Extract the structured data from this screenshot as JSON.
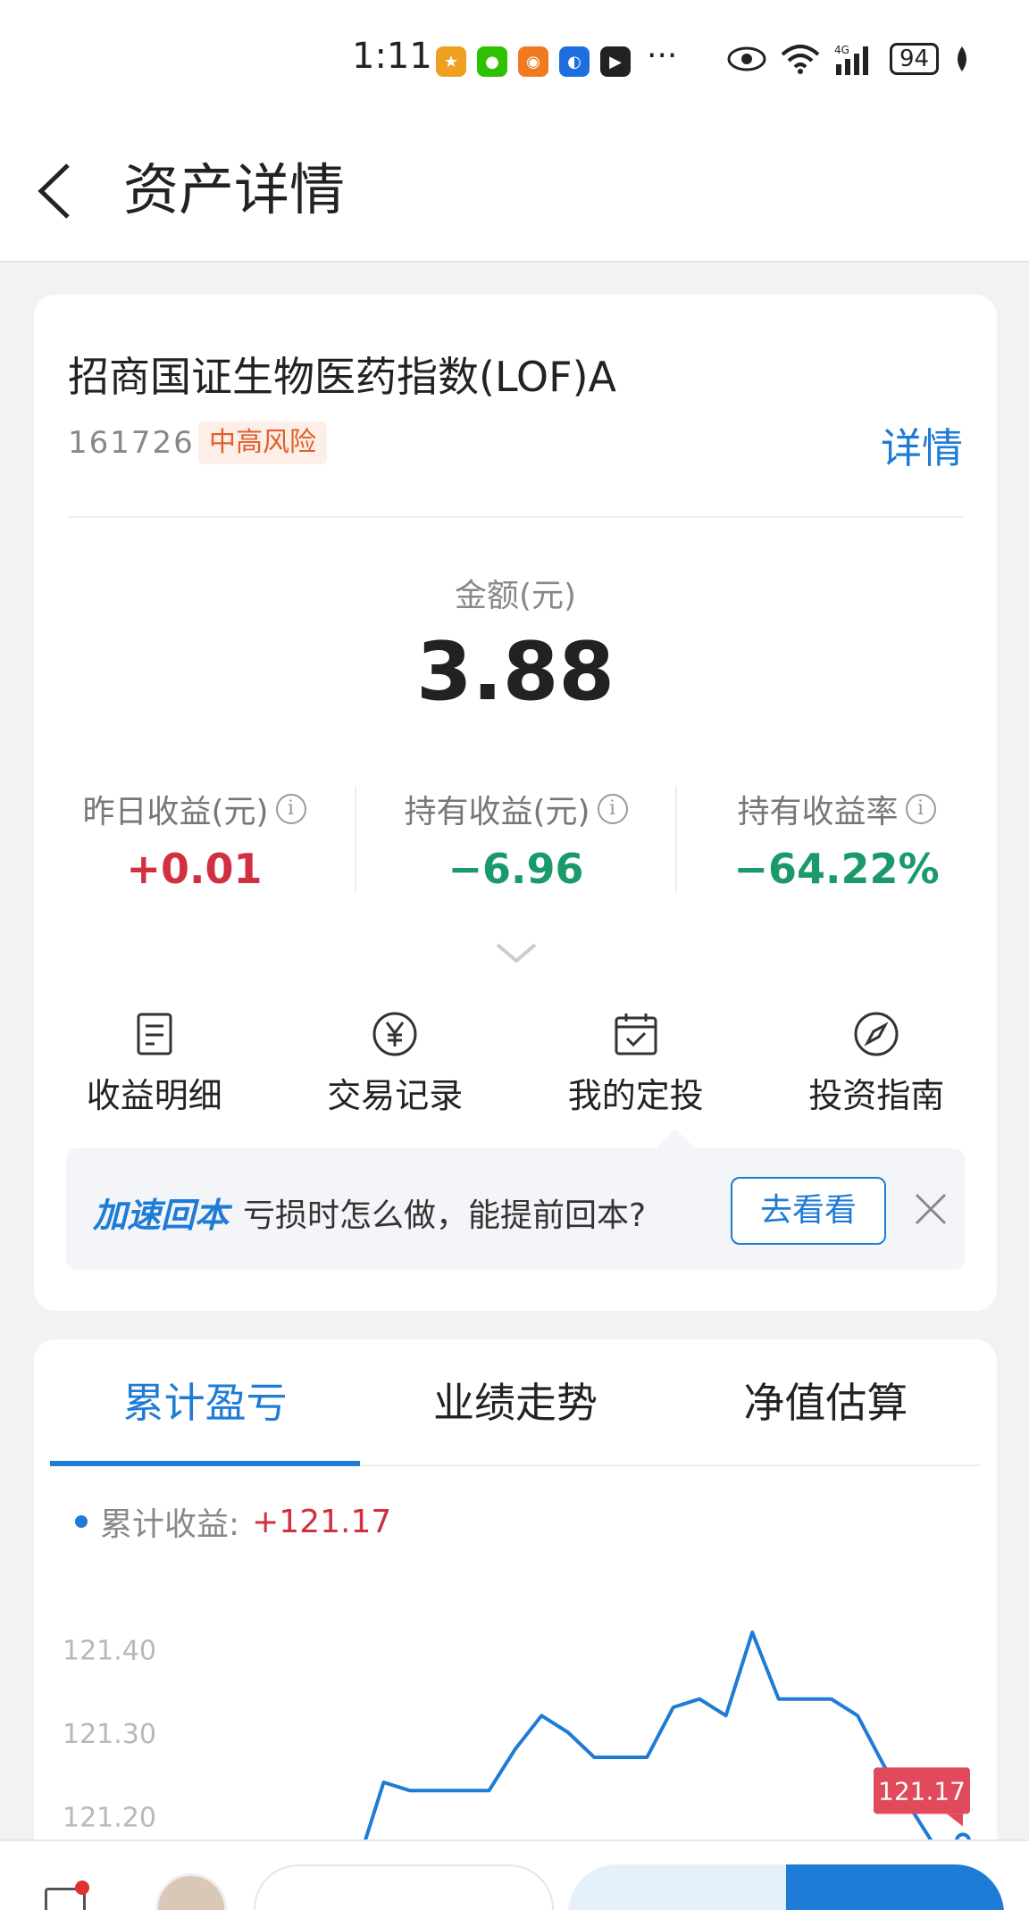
{
  "status_bar": {
    "time": "1:11",
    "battery": "94",
    "network": "4G"
  },
  "nav": {
    "title": "资产详情"
  },
  "fund": {
    "name": "招商国证生物医药指数(LOF)A",
    "code": "161726",
    "risk": "中高风险",
    "detail_link": "详情",
    "amount_label": "金额(元)",
    "amount_value": "3.88"
  },
  "metrics": [
    {
      "label": "昨日收益(元)",
      "value": "+0.01",
      "color": "#d03040"
    },
    {
      "label": "持有收益(元)",
      "value": "−6.96",
      "color": "#1a9a6a"
    },
    {
      "label": "持有收益率",
      "value": "−64.22%",
      "color": "#1a9a6a"
    }
  ],
  "actions": [
    {
      "label": "收益明细",
      "icon": "document-icon"
    },
    {
      "label": "交易记录",
      "icon": "yen-circle-icon"
    },
    {
      "label": "我的定投",
      "icon": "calendar-check-icon"
    },
    {
      "label": "投资指南",
      "icon": "compass-icon"
    }
  ],
  "promo": {
    "tag": "加速回本",
    "text": "亏损时怎么做，能提前回本?",
    "button": "去看看"
  },
  "tabs": [
    "累计盈亏",
    "业绩走势",
    "净值估算"
  ],
  "active_tab": 0,
  "legend": {
    "label": "累计收益:",
    "value": "+121.17"
  },
  "chart_data": {
    "type": "line",
    "y_ticks": [
      "121.40",
      "121.30",
      "121.20"
    ],
    "ylim": [
      121.15,
      121.45
    ],
    "series": [
      {
        "values": [
          121.14,
          121.24,
          121.23,
          121.23,
          121.23,
          121.23,
          121.28,
          121.32,
          121.3,
          121.27,
          121.27,
          121.27,
          121.33,
          121.34,
          121.32,
          121.42,
          121.34,
          121.34,
          121.34,
          121.32,
          121.26,
          121.21,
          121.16,
          121.17
        ],
        "color": "#1e7bd6"
      }
    ],
    "last_value_label": "121.17",
    "label_color": "#e04a5a"
  }
}
